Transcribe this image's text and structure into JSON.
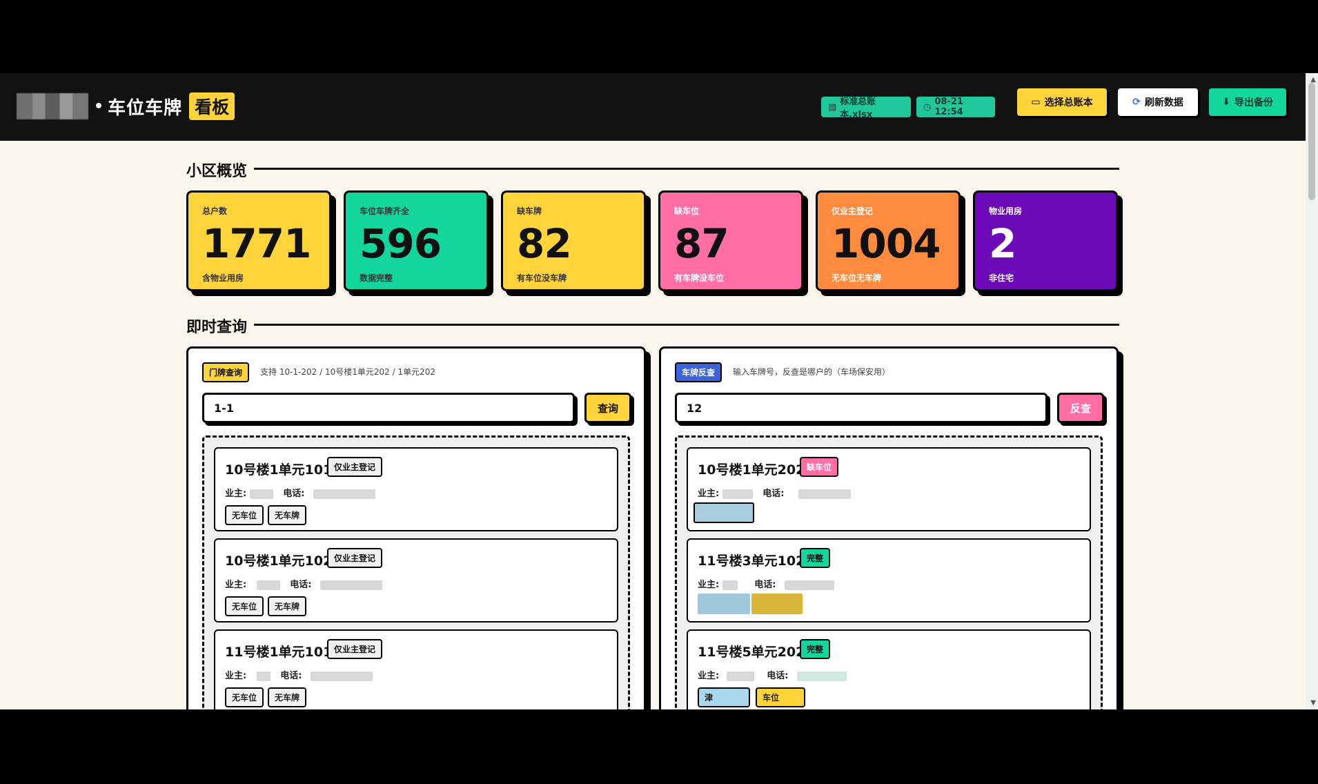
{
  "header": {
    "title": "车位车牌",
    "badge": "看板",
    "file_chip": "标准总账本.xlsx",
    "time_chip": "08-21 12:54",
    "btn_select": "选择总账本",
    "btn_refresh": "刷新数据",
    "btn_export": "导出备份"
  },
  "overview": {
    "section_title": "小区概览",
    "stats": [
      {
        "label": "总户数",
        "value": "1771",
        "sub": "含物业用房",
        "color": "#ffd43b"
      },
      {
        "label": "车位车牌齐全",
        "value": "596",
        "sub": "数据完整",
        "color": "#12d69b"
      },
      {
        "label": "缺车牌",
        "value": "82",
        "sub": "有车位没车牌",
        "color": "#ffd43b"
      },
      {
        "label": "缺车位",
        "value": "87",
        "sub": "有车牌没车位",
        "color": "#ff6fa3"
      },
      {
        "label": "仅业主登记",
        "value": "1004",
        "sub": "无车位无车牌",
        "color": "#ff8c3e"
      },
      {
        "label": "物业用房",
        "value": "2",
        "sub": "非住宅",
        "color": "#6d0ab8"
      }
    ]
  },
  "query": {
    "section_title": "即时查询",
    "left": {
      "tag": "门牌查询",
      "hint": "支持 10-1-202 / 10号楼1单元202 / 1单元202",
      "input_value": "1-1",
      "button": "查询",
      "results": [
        {
          "title": "10号楼1单元101",
          "badge": "仅业主登记",
          "owner_label": "业主:",
          "phone_label": "电话:",
          "pills": [
            "无车位",
            "无车牌"
          ]
        },
        {
          "title": "10号楼1单元102",
          "badge": "仅业主登记",
          "owner_label": "业主:",
          "phone_label": "电话:",
          "pills": [
            "无车位",
            "无车牌"
          ]
        },
        {
          "title": "11号楼1单元101",
          "badge": "仅业主登记",
          "owner_label": "业主:",
          "phone_label": "电话:",
          "pills": [
            "无车位",
            "无车牌"
          ]
        }
      ]
    },
    "right": {
      "tag": "车牌反查",
      "hint": "输入车牌号，反查是哪户的（车场保安用）",
      "input_value": "12",
      "button": "反查",
      "results": [
        {
          "title": "10号楼1单元202",
          "badge": "缺车位",
          "badge_color": "#ff6fa3",
          "owner_label": "业主:",
          "phone_label": "电话:",
          "pills": []
        },
        {
          "title": "11号楼3单元102",
          "badge": "完整",
          "badge_color": "#12d69b",
          "owner_label": "业主:",
          "phone_label": "电话:",
          "pills": []
        },
        {
          "title": "11号楼5单元202",
          "badge": "完整",
          "badge_color": "#12d69b",
          "owner_label": "业主:",
          "phone_label": "电话:",
          "pills": [
            "津",
            "车位"
          ]
        }
      ]
    }
  }
}
